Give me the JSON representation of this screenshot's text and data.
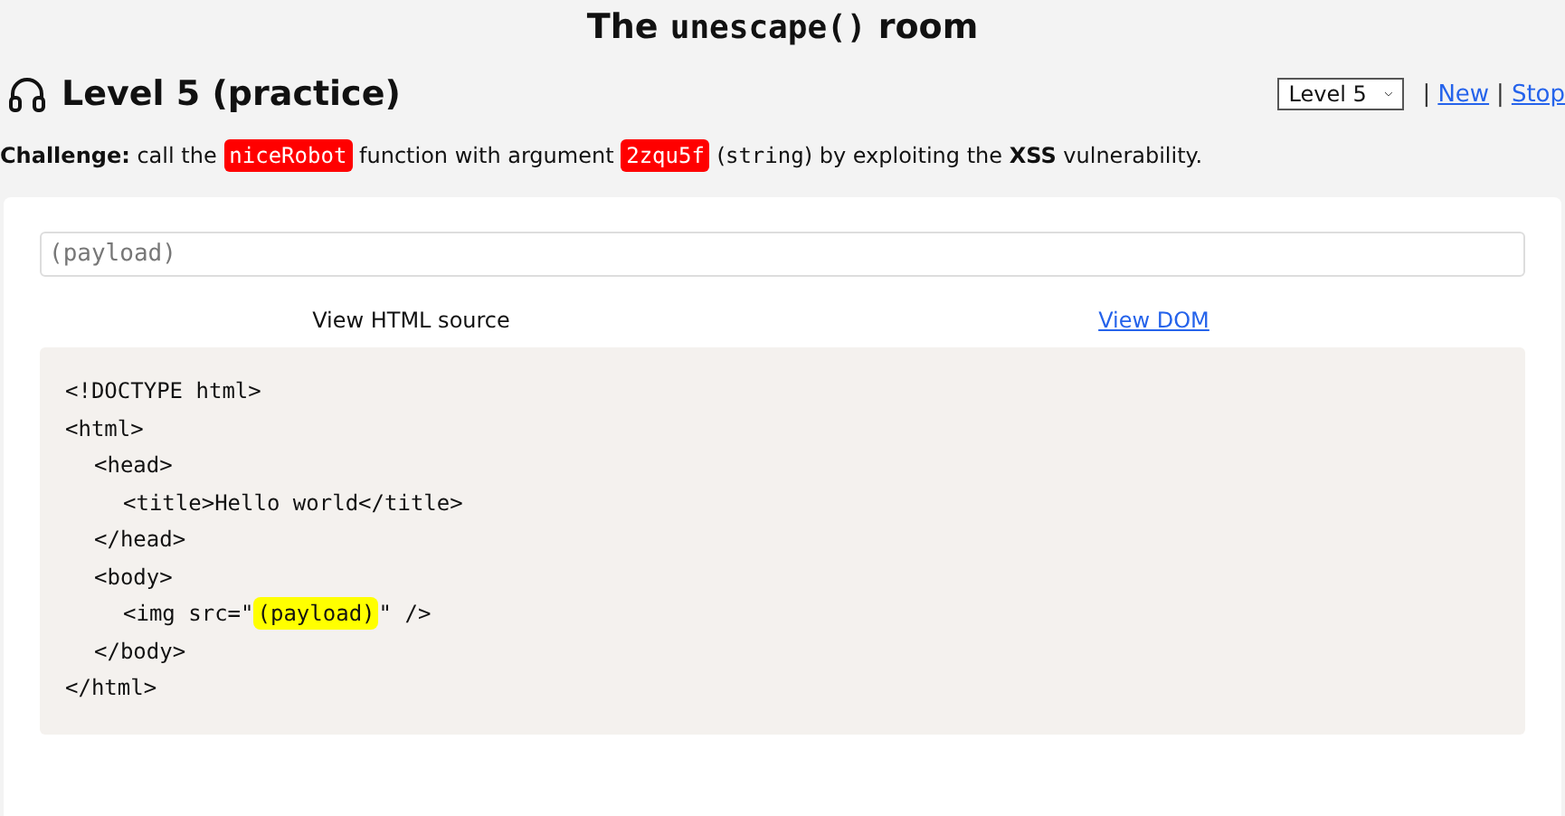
{
  "title": [
    {
      "kind": "text",
      "text": "The "
    },
    {
      "kind": "code",
      "text": "unescape()"
    },
    {
      "kind": "text",
      "text": " room"
    }
  ],
  "level_heading": "Level 5 (practice)",
  "level_select": {
    "value": "Level 5"
  },
  "nav": [
    {
      "kind": "separator",
      "text": "|"
    },
    {
      "kind": "link",
      "text": "New"
    },
    {
      "kind": "separator",
      "text": "|"
    },
    {
      "kind": "link",
      "text": "Stop"
    }
  ],
  "challenge": [
    {
      "kind": "bold",
      "text": "Challenge:"
    },
    {
      "kind": "text",
      "text": " call the "
    },
    {
      "kind": "token",
      "text": "niceRobot"
    },
    {
      "kind": "text",
      "text": " function with argument "
    },
    {
      "kind": "token",
      "text": "2zqu5f"
    },
    {
      "kind": "text",
      "text": " ("
    },
    {
      "kind": "code",
      "text": "string"
    },
    {
      "kind": "text",
      "text": ") by exploiting the "
    },
    {
      "kind": "bold",
      "text": "XSS"
    },
    {
      "kind": "text",
      "text": " vulnerability."
    }
  ],
  "payload_field": {
    "placeholder": "(payload)"
  },
  "tabs": [
    {
      "label": "View HTML source",
      "selected": true
    },
    {
      "label": "View DOM",
      "selected": false
    }
  ],
  "source": [
    {
      "parts": [
        {
          "kind": "code",
          "text": "<!DOCTYPE html>"
        }
      ]
    },
    {
      "parts": [
        {
          "kind": "code",
          "text": "<html>"
        }
      ],
      "children": [
        {
          "parts": [
            {
              "kind": "code",
              "text": "<head>"
            }
          ],
          "children": [
            {
              "parts": [
                {
                  "kind": "code",
                  "text": "<title>Hello world</title>"
                }
              ]
            }
          ]
        },
        {
          "parts": [
            {
              "kind": "code",
              "text": "</head>"
            }
          ]
        },
        {
          "parts": [
            {
              "kind": "code",
              "text": "<body>"
            }
          ],
          "children": [
            {
              "parts": [
                {
                  "kind": "code",
                  "text": "<img src=\""
                },
                {
                  "kind": "highlight",
                  "text": "(payload)"
                },
                {
                  "kind": "code",
                  "text": "\" />"
                }
              ]
            }
          ]
        },
        {
          "parts": [
            {
              "kind": "code",
              "text": "</body>"
            }
          ]
        }
      ]
    },
    {
      "parts": [
        {
          "kind": "code",
          "text": "</html>"
        }
      ]
    }
  ]
}
